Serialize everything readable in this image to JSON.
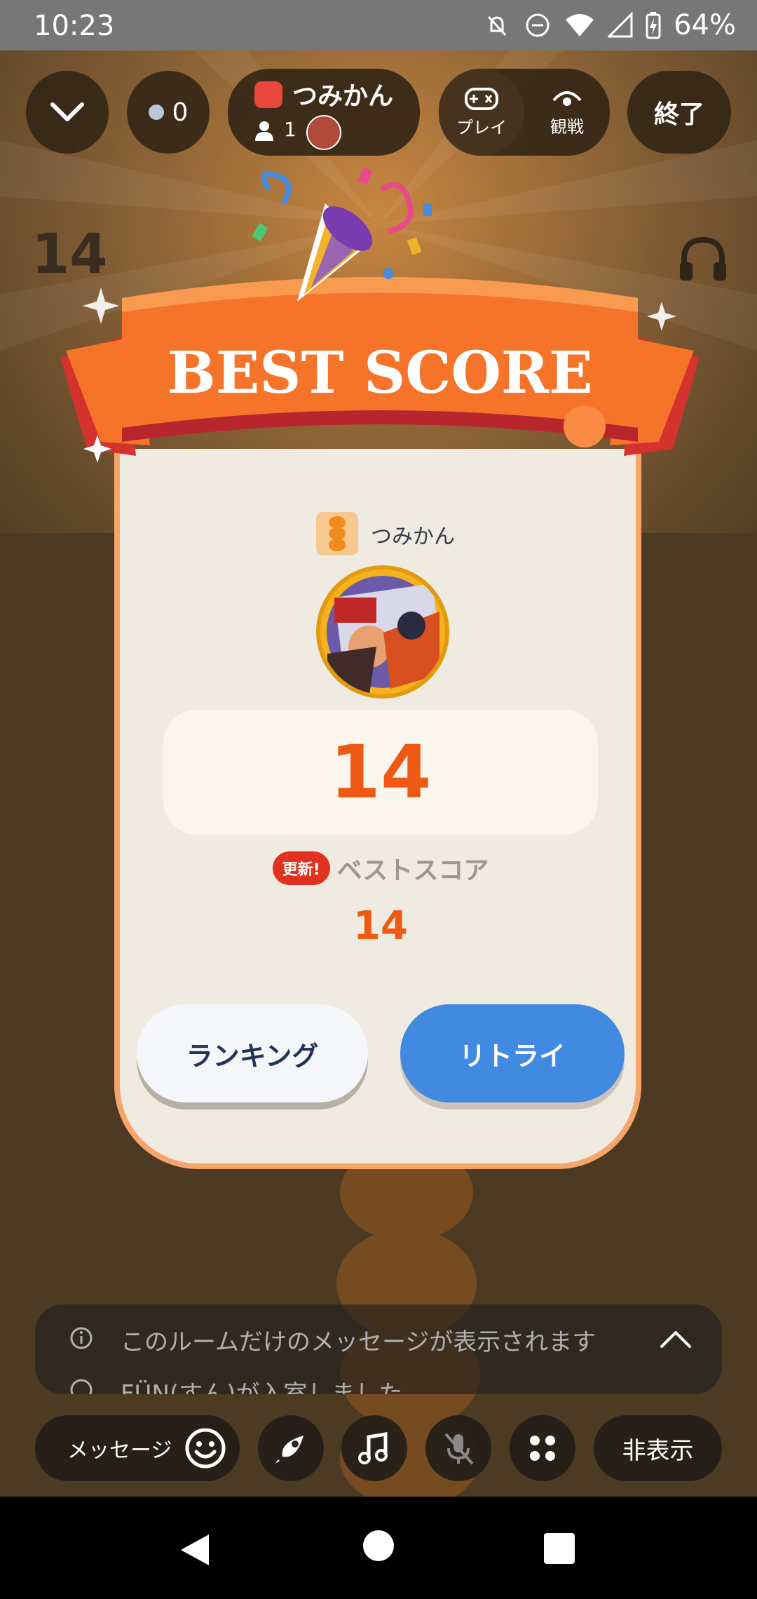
{
  "status_bar": {
    "time": "10:23",
    "battery": "64%",
    "icons": [
      "mute-icon",
      "dnd-icon",
      "wifi-icon",
      "signal-icon",
      "battery-charging-icon"
    ]
  },
  "top_bar": {
    "member_dot_count": "0",
    "room": {
      "name": "つみかん",
      "member_count": "1"
    },
    "play_label": "プレイ",
    "watch_label": "観戦",
    "end_label": "終了"
  },
  "background": {
    "score": "14"
  },
  "result": {
    "banner_title": "BEST SCORE",
    "player_name": "つみかん",
    "score": "14",
    "updated_badge": "更新!",
    "best_label": "ベストスコア",
    "best_value": "14",
    "ranking_label": "ランキング",
    "retry_label": "リトライ"
  },
  "messages": {
    "line1": "このルームだけのメッセージが表示されます",
    "line2": "FÜN(すん)が入室しました"
  },
  "toolbar": {
    "message_label": "メッセージ",
    "hide_label": "非表示"
  },
  "colors": {
    "accent_orange": "#ee5a14",
    "retry_blue": "#4289e2",
    "banner_orange": "#f5742a",
    "card_bg": "#f0ebe1"
  }
}
